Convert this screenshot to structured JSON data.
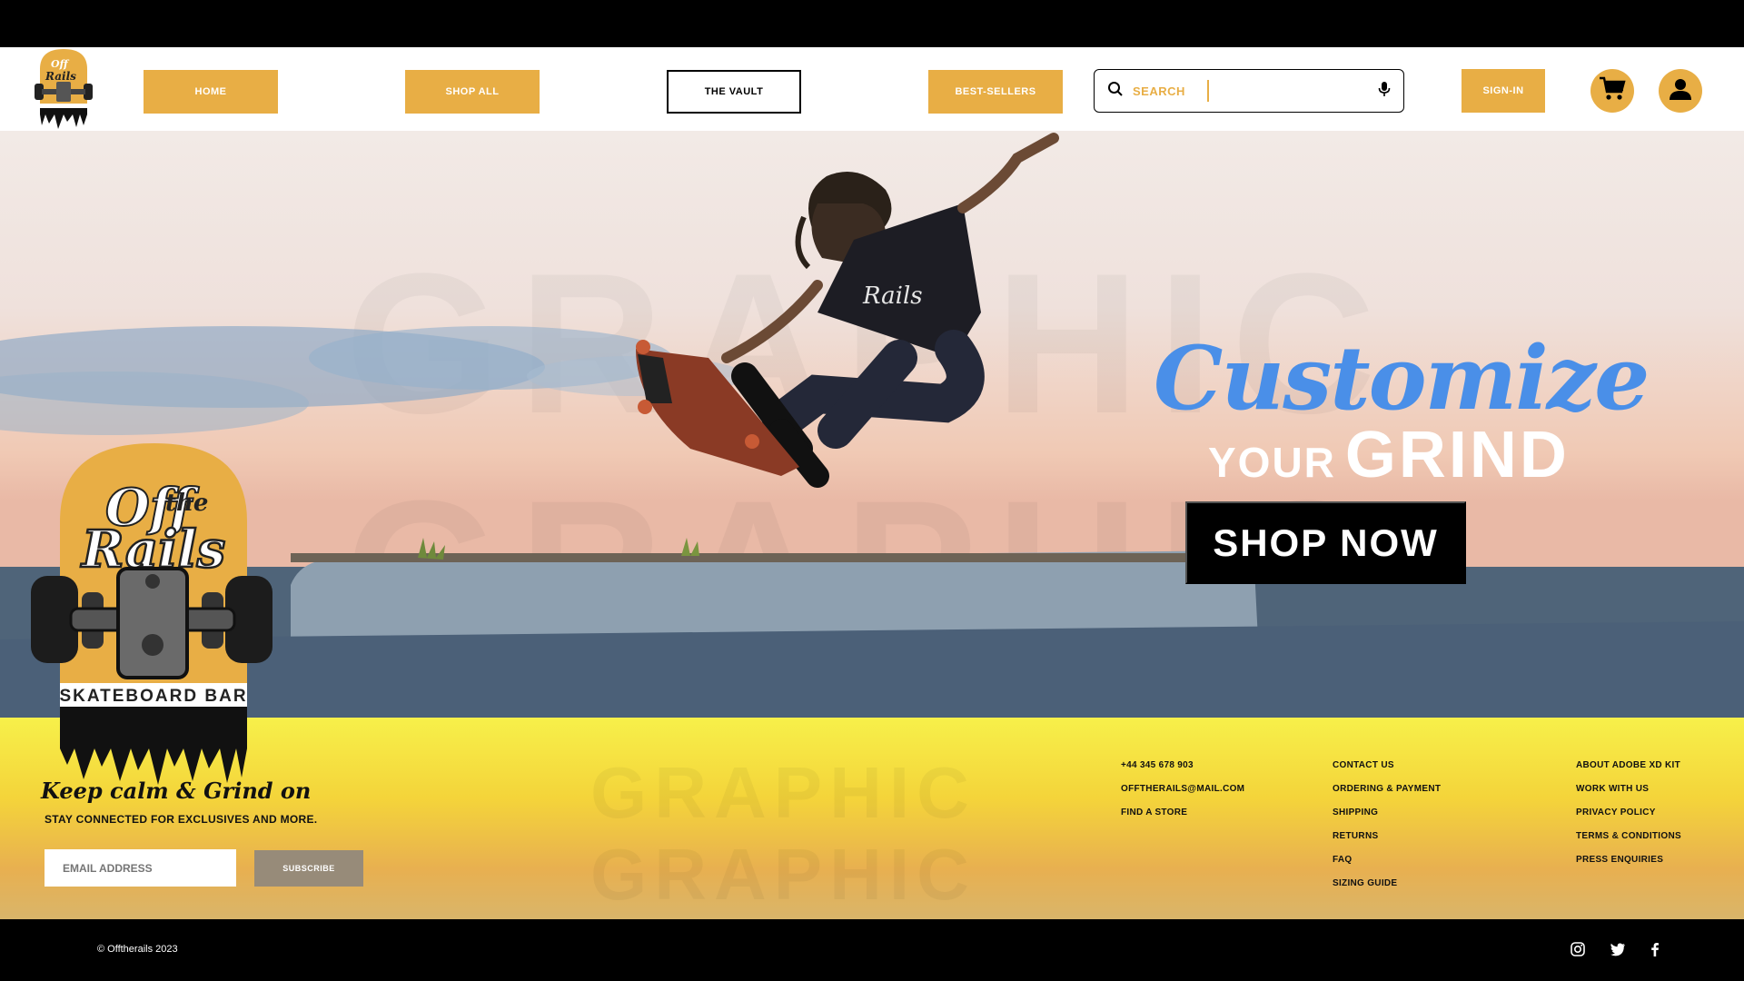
{
  "nav": {
    "home": "HOME",
    "shop_all": "SHOP ALL",
    "vault": "THE VAULT",
    "best_sellers": "BEST-SELLERS",
    "search_placeholder": "SEARCH",
    "sign_in": "SIGN-IN",
    "logo_lines": [
      "Off",
      "the",
      "Rails",
      "SKATEBOARD BAR"
    ]
  },
  "hero": {
    "headline_script": "Customize",
    "headline_small": "YOUR",
    "headline_big": "GRIND",
    "cta": "SHOP NOW",
    "skater_shirt_text": "Rails"
  },
  "brand": {
    "off": "Off",
    "the": "the",
    "rails": "Rails",
    "tagline": "SKATEBOARD BAR"
  },
  "newsletter": {
    "heading": "Keep calm & Grind on",
    "subheading": "STAY CONNECTED FOR EXCLUSIVES AND MORE.",
    "email_placeholder": "EMAIL ADDRESS",
    "subscribe": "SUBSCRIBE"
  },
  "footer": {
    "contact": [
      "+44 345 678 903",
      "OFFTHERAILS@MAIL.COM",
      "FIND A STORE"
    ],
    "help": [
      "CONTACT US",
      "ORDERING & PAYMENT",
      "SHIPPING",
      "RETURNS",
      "FAQ",
      "SIZING GUIDE"
    ],
    "company": [
      "ABOUT ADOBE XD KIT",
      "WORK WITH US",
      "PRIVACY POLICY",
      "TERMS & CONDITIONS",
      "PRESS ENQUIRIES"
    ]
  },
  "bottom": {
    "copyright": "© Offtherails 2023",
    "social_icons": [
      "instagram-icon",
      "twitter-icon",
      "facebook-icon"
    ]
  },
  "colors": {
    "accent": "#E8AE45",
    "headline_blue": "#4A8FE8",
    "footer_yellow": "#F7F04A"
  }
}
